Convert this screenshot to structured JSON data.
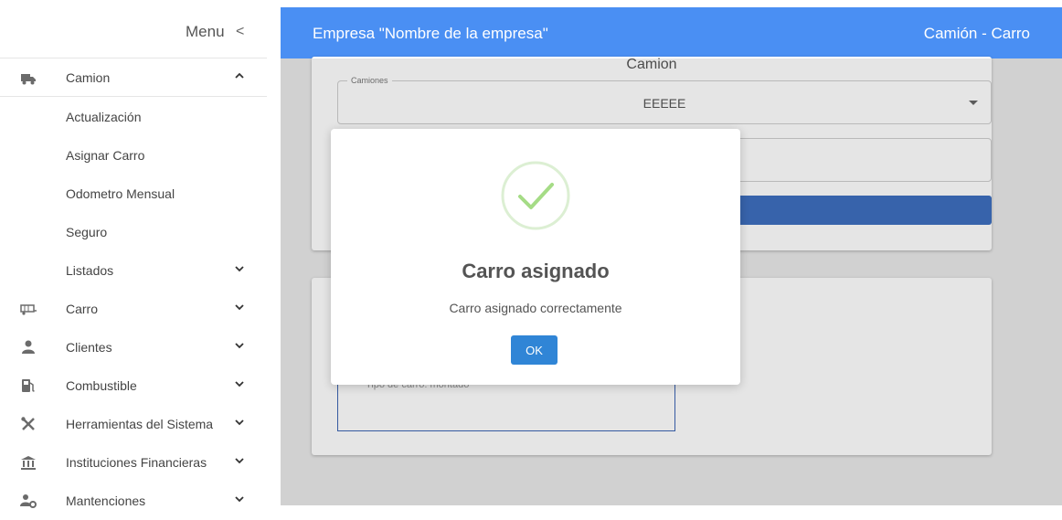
{
  "menu": {
    "title": "Menu",
    "collapse_glyph": "<"
  },
  "sidebar": {
    "items": [
      {
        "label": "Camion",
        "icon": "truck-icon",
        "state": "expanded"
      },
      {
        "label": "Actualización"
      },
      {
        "label": "Asignar Carro"
      },
      {
        "label": "Odometro Mensual"
      },
      {
        "label": "Seguro"
      },
      {
        "label": "Listados",
        "state": "collapsed"
      },
      {
        "label": "Carro",
        "icon": "trailer-icon",
        "state": "collapsed"
      },
      {
        "label": "Clientes",
        "icon": "user-icon",
        "state": "collapsed"
      },
      {
        "label": "Combustible",
        "icon": "gas-station-icon",
        "state": "collapsed"
      },
      {
        "label": "Herramientas del Sistema",
        "icon": "tools-icon",
        "state": "collapsed"
      },
      {
        "label": "Instituciones Financieras",
        "icon": "bank-icon",
        "state": "collapsed"
      },
      {
        "label": "Mantenciones",
        "icon": "user-gear-icon",
        "state": "collapsed"
      }
    ]
  },
  "header": {
    "title": "Empresa \"Nombre de la empresa\"",
    "right": "Camión - Carro"
  },
  "form": {
    "title": "Camion",
    "camiones_legend": "Camiones",
    "camiones_value": "EEEEE",
    "textarea_placeholder": "Tipo de carro: montado"
  },
  "dialog": {
    "icon": "success-check-icon",
    "title": "Carro asignado",
    "message": "Carro asignado correctamente",
    "ok_label": "OK"
  },
  "colors": {
    "accent": "#4a8ff3",
    "primary_button": "#3e6fbf",
    "ok_button": "#3085d6",
    "success": "#a5dc86"
  }
}
